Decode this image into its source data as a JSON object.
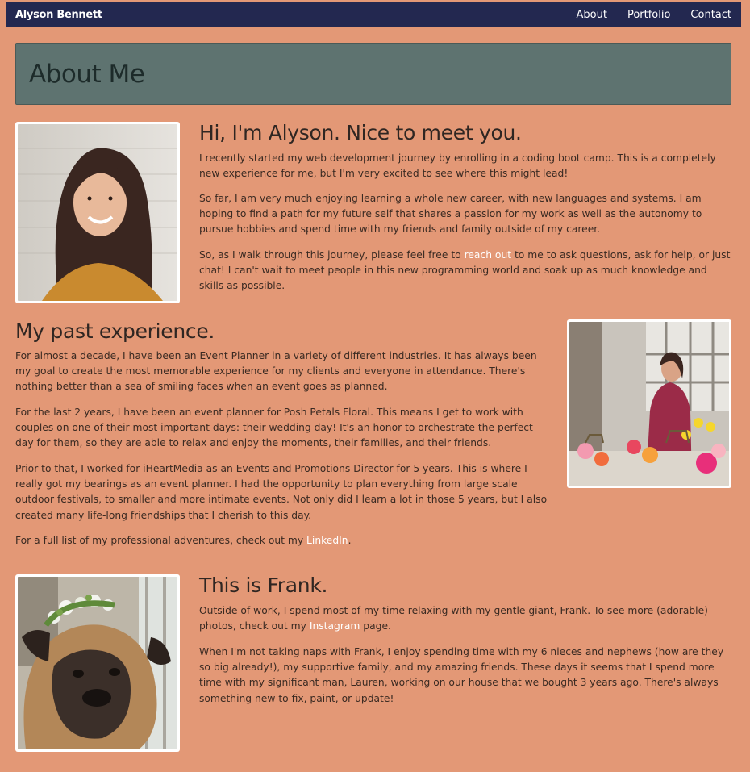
{
  "navbar": {
    "brand": "Alyson Bennett",
    "links": [
      "About",
      "Portfolio",
      "Contact"
    ]
  },
  "hero": {
    "title": "About Me"
  },
  "intro": {
    "heading": "Hi, I'm Alyson. Nice to meet you.",
    "p1": "I recently started my web development journey by enrolling in a coding boot camp. This is a completely new experience for me, but I'm very excited to see where this might lead!",
    "p2": "So far, I am very much enjoying learning a whole new career, with new languages and systems. I am hoping to find a path for my future self that shares a passion for my work as well as the autonomy to pursue hobbies and spend time with my friends and family outside of my career.",
    "p3_before": "So, as I walk through this journey, please feel free to ",
    "p3_link": "reach out",
    "p3_after": " to me to ask questions, ask for help, or just chat! I can't wait to meet people in this new programming world and soak up as much knowledge and skills as possible."
  },
  "experience": {
    "heading": "My past experience.",
    "p1": "For almost a decade, I have been an Event Planner in a variety of different industries. It has always been my goal to create the most memorable experience for my clients and everyone in attendance. There's nothing better than a sea of smiling faces when an event goes as planned.",
    "p2": "For the last 2 years, I have been an event planner for Posh Petals Floral. This means I get to work with couples on one of their most important days: their wedding day! It's an honor to orchestrate the perfect day for them, so they are able to relax and enjoy the moments, their families, and their friends.",
    "p3": "Prior to that, I worked for iHeartMedia as an Events and Promotions Director for 5 years. This is where I really got my bearings as an event planner. I had the opportunity to plan everything from large scale outdoor festivals, to smaller and more intimate events. Not only did I learn a lot in those 5 years, but I also created many life-long friendships that I cherish to this day.",
    "p4_before": "For a full list of my professional adventures, check out my ",
    "p4_link": "LinkedIn",
    "p4_after": "."
  },
  "frank": {
    "heading": "This is Frank.",
    "p1_before": "Outside of work, I spend most of my time relaxing with my gentle giant, Frank. To see more (adorable) photos, check out my ",
    "p1_link": "Instagram",
    "p1_after": " page.",
    "p2": "When I'm not taking naps with Frank, I enjoy spending time with my 6 nieces and nephews (how are they so big already!), my supportive family, and my amazing friends. These days it seems that I spend more time with my significant man, Lauren, working on our house that we bought 3 years ago. There's always something new to fix, paint, or update!"
  },
  "colors": {
    "page_bg": "#e39876",
    "navbar_bg": "#232850",
    "hero_bg": "#5e7370",
    "link": "#ffffff"
  }
}
